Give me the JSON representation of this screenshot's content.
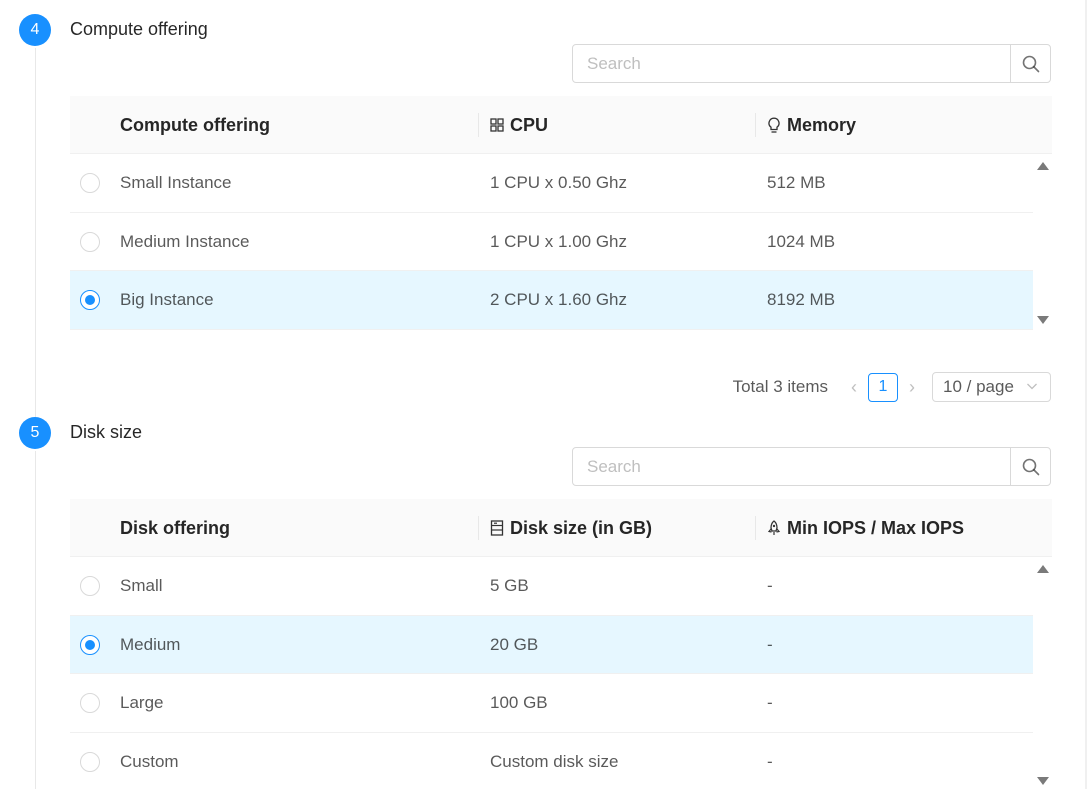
{
  "colors": {
    "accent": "#1890ff",
    "selected_row": "#e6f7ff"
  },
  "compute": {
    "step_number": "4",
    "title": "Compute offering",
    "search_placeholder": "Search",
    "columns": [
      {
        "label": "Compute offering",
        "icon": ""
      },
      {
        "label": "CPU",
        "icon": "grid-icon"
      },
      {
        "label": "Memory",
        "icon": "bulb-icon"
      }
    ],
    "rows": [
      {
        "name": "Small Instance",
        "cpu": "1 CPU x 0.50 Ghz",
        "memory": "512 MB",
        "selected": false
      },
      {
        "name": "Medium Instance",
        "cpu": "1 CPU x 1.00 Ghz",
        "memory": "1024 MB",
        "selected": false
      },
      {
        "name": "Big Instance",
        "cpu": "2 CPU x 1.60 Ghz",
        "memory": "8192 MB",
        "selected": true
      }
    ],
    "pagination": {
      "total": "Total 3 items",
      "current_page": "1",
      "page_size": "10 / page"
    }
  },
  "disk": {
    "step_number": "5",
    "title": "Disk size",
    "search_placeholder": "Search",
    "columns": [
      {
        "label": "Disk offering",
        "icon": ""
      },
      {
        "label": "Disk size (in GB)",
        "icon": "hdd-icon"
      },
      {
        "label": "Min IOPS / Max IOPS",
        "icon": "rocket-icon"
      }
    ],
    "rows": [
      {
        "name": "Small",
        "size": "5 GB",
        "iops": "-",
        "selected": false
      },
      {
        "name": "Medium",
        "size": "20 GB",
        "iops": "-",
        "selected": true
      },
      {
        "name": "Large",
        "size": "100 GB",
        "iops": "-",
        "selected": false
      },
      {
        "name": "Custom",
        "size": "Custom disk size",
        "iops": "-",
        "selected": false
      }
    ]
  }
}
